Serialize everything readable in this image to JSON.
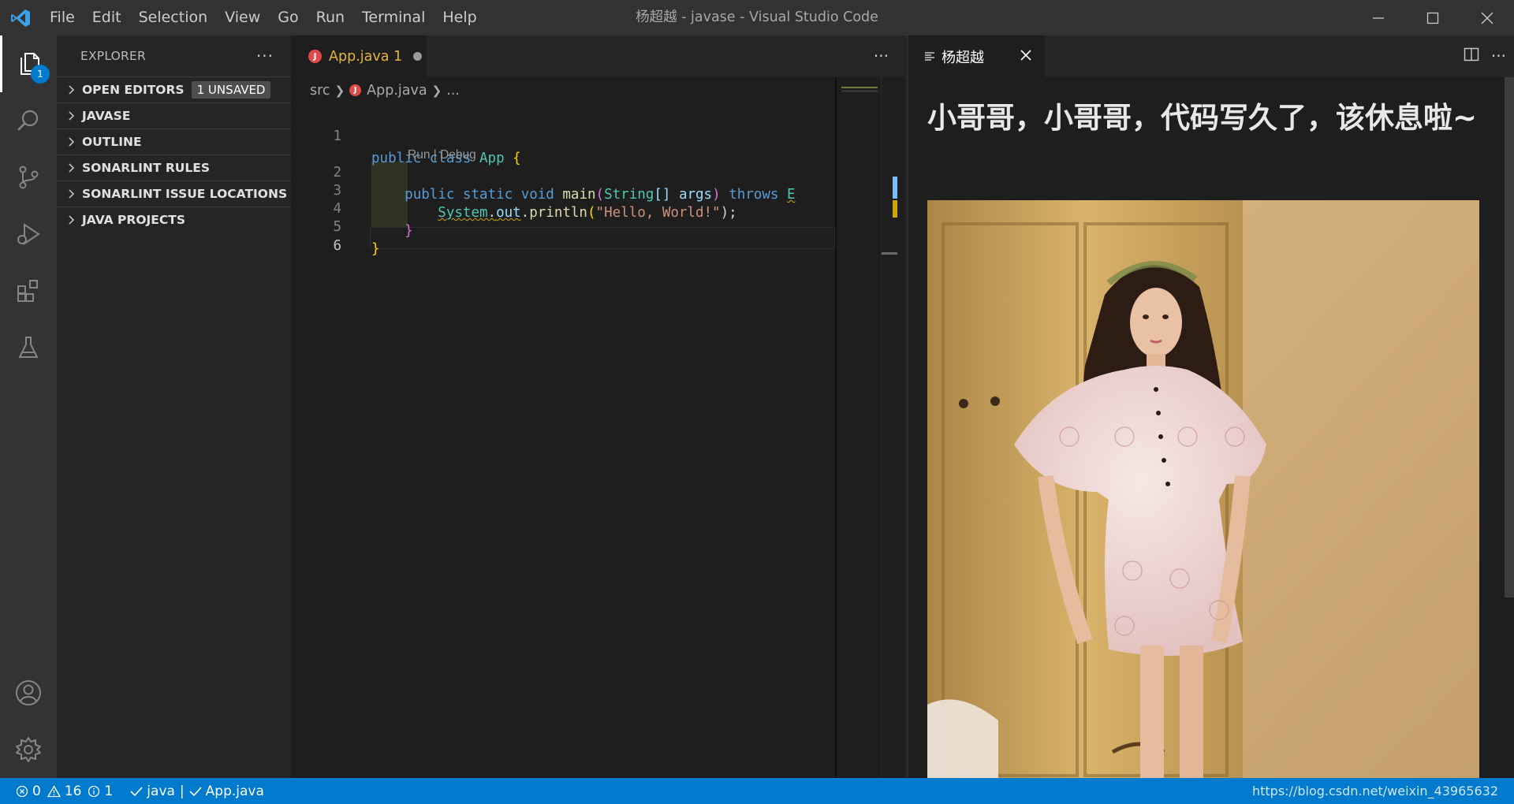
{
  "window": {
    "title": "杨超越 - javase - Visual Studio Code"
  },
  "menu": [
    "File",
    "Edit",
    "Selection",
    "View",
    "Go",
    "Run",
    "Terminal",
    "Help"
  ],
  "activity": {
    "explorer_badge": "1"
  },
  "sidebar": {
    "title": "EXPLORER",
    "more": "···",
    "sections": [
      {
        "label": "OPEN EDITORS",
        "badge": "1 UNSAVED"
      },
      {
        "label": "JAVASE"
      },
      {
        "label": "OUTLINE"
      },
      {
        "label": "SONARLINT RULES"
      },
      {
        "label": "SONARLINT ISSUE LOCATIONS"
      },
      {
        "label": "JAVA PROJECTS"
      }
    ]
  },
  "editor": {
    "tab_label": "App.java 1",
    "tab_icon_letter": "J",
    "more": "···",
    "breadcrumb": {
      "folder": "src",
      "file": "App.java",
      "tail": "..."
    },
    "codelens": "Run | Debug",
    "line_numbers": [
      "1",
      "2",
      "3",
      "4",
      "5",
      "6"
    ],
    "code": {
      "l1": {
        "kw1": "public",
        "kw2": "class",
        "name": "App",
        "brace": "{"
      },
      "l2": {
        "kw1": "public",
        "kw2": "static",
        "kw3": "void",
        "fn": "main",
        "p1": "(",
        "type": "String",
        "arr": "[]",
        "arg": "args",
        "p2": ")",
        "kw4": "throws",
        "exc": "E"
      },
      "l3": {
        "obj": "System",
        "dot1": ".",
        "field": "out",
        "dot2": ".",
        "fn": "println",
        "p1": "(",
        "str": "\"Hello, World!\"",
        "p2": ");"
      },
      "l4": {
        "brace": "}"
      },
      "l5": {
        "brace": "}"
      }
    }
  },
  "preview": {
    "tab_label": "杨超越",
    "heading": "小哥哥，小哥哥，代码写久了，该休息啦~"
  },
  "statusbar": {
    "errors": "0",
    "warnings": "16",
    "infos": "1",
    "java": "java",
    "file": "App.java",
    "url": "https://blog.csdn.net/weixin_43965632"
  },
  "colors": {
    "accent": "#007acc",
    "tab_modified": "#e3b341",
    "java_icon": "#e24a4a"
  }
}
